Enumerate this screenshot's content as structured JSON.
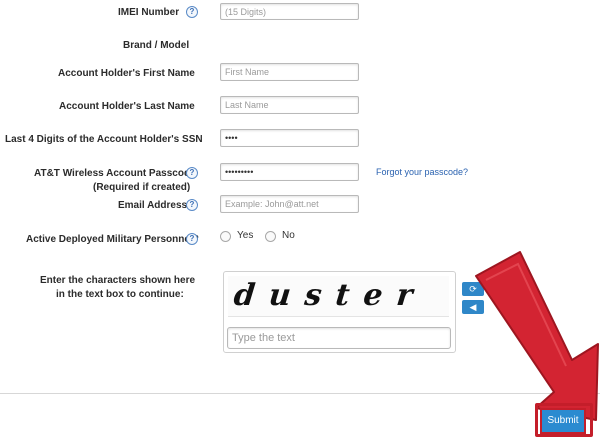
{
  "form": {
    "imei": {
      "label": "IMEI Number",
      "help": "?",
      "placeholder": "(15 Digits)"
    },
    "brand": {
      "label": "Brand / Model"
    },
    "first_name": {
      "label": "Account Holder's First Name",
      "placeholder": "First Name"
    },
    "last_name": {
      "label": "Account Holder's Last Name",
      "placeholder": "Last Name"
    },
    "ssn": {
      "label": "Last 4 Digits of the Account Holder's SSN",
      "value": "••••"
    },
    "passcode": {
      "label_line1": "AT&T Wireless Account Passcode",
      "label_line2": "(Required if created)",
      "help": "?",
      "value": "•••••••••",
      "forgot_link": "Forgot your passcode?"
    },
    "email": {
      "label": "Email Address",
      "help": "?",
      "placeholder": "Example: John@att.net"
    },
    "military": {
      "label": "Active Deployed Military Personnel?",
      "help": "?",
      "yes": "Yes",
      "no": "No"
    },
    "captcha": {
      "label_line1": "Enter the characters shown here",
      "label_line2": "in the text box to continue:",
      "text": "duster",
      "refresh_icon": "refresh-icon",
      "audio_icon": "audio-icon",
      "input_placeholder": "Type the text"
    },
    "submit_label": "Submit"
  },
  "colors": {
    "accent": "#2b8bd0",
    "annotation_red": "#c41e2a",
    "link": "#2a62b0"
  }
}
